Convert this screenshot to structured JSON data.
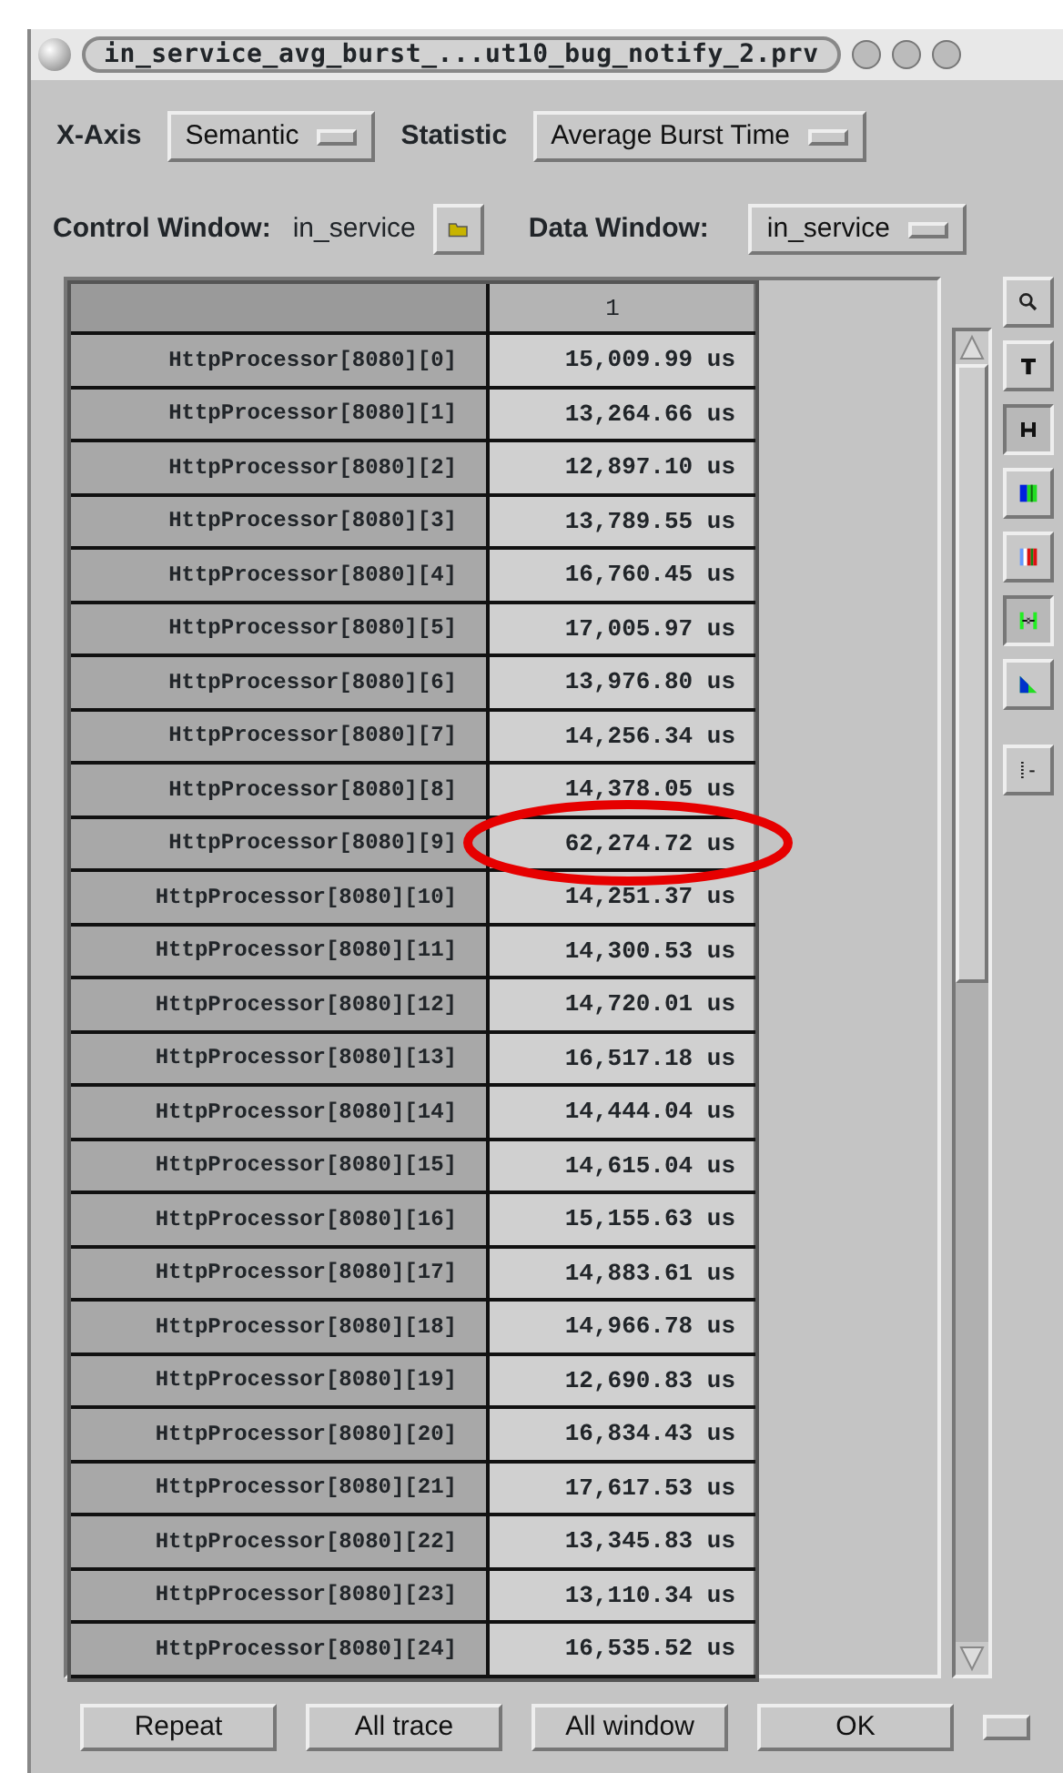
{
  "window": {
    "title": "in_service_avg_burst_...ut10_bug_notify_2.prv"
  },
  "x_axis": {
    "label": "X-Axis",
    "value": "Semantic"
  },
  "statistic": {
    "label": "Statistic",
    "value": "Average Burst Time"
  },
  "control_window": {
    "label": "Control Window:",
    "value": "in_service"
  },
  "data_window": {
    "label": "Data Window:",
    "value": "in_service"
  },
  "table": {
    "columns": [
      "1"
    ],
    "rows": [
      {
        "label": "HttpProcessor[8080][0]",
        "value": "15,009.99 us"
      },
      {
        "label": "HttpProcessor[8080][1]",
        "value": "13,264.66 us"
      },
      {
        "label": "HttpProcessor[8080][2]",
        "value": "12,897.10 us"
      },
      {
        "label": "HttpProcessor[8080][3]",
        "value": "13,789.55 us"
      },
      {
        "label": "HttpProcessor[8080][4]",
        "value": "16,760.45 us"
      },
      {
        "label": "HttpProcessor[8080][5]",
        "value": "17,005.97 us"
      },
      {
        "label": "HttpProcessor[8080][6]",
        "value": "13,976.80 us"
      },
      {
        "label": "HttpProcessor[8080][7]",
        "value": "14,256.34 us"
      },
      {
        "label": "HttpProcessor[8080][8]",
        "value": "14,378.05 us"
      },
      {
        "label": "HttpProcessor[8080][9]",
        "value": "62,274.72 us"
      },
      {
        "label": "HttpProcessor[8080][10]",
        "value": "14,251.37 us"
      },
      {
        "label": "HttpProcessor[8080][11]",
        "value": "14,300.53 us"
      },
      {
        "label": "HttpProcessor[8080][12]",
        "value": "14,720.01 us"
      },
      {
        "label": "HttpProcessor[8080][13]",
        "value": "16,517.18 us"
      },
      {
        "label": "HttpProcessor[8080][14]",
        "value": "14,444.04 us"
      },
      {
        "label": "HttpProcessor[8080][15]",
        "value": "14,615.04 us"
      },
      {
        "label": "HttpProcessor[8080][16]",
        "value": "15,155.63 us"
      },
      {
        "label": "HttpProcessor[8080][17]",
        "value": "14,883.61 us"
      },
      {
        "label": "HttpProcessor[8080][18]",
        "value": "14,966.78 us"
      },
      {
        "label": "HttpProcessor[8080][19]",
        "value": "12,690.83 us"
      },
      {
        "label": "HttpProcessor[8080][20]",
        "value": "16,834.43 us"
      },
      {
        "label": "HttpProcessor[8080][21]",
        "value": "17,617.53 us"
      },
      {
        "label": "HttpProcessor[8080][22]",
        "value": "13,345.83 us"
      },
      {
        "label": "HttpProcessor[8080][23]",
        "value": "13,110.34 us"
      },
      {
        "label": "HttpProcessor[8080][24]",
        "value": "16,535.52 us"
      }
    ]
  },
  "toolbar": [
    {
      "kind": "zoom",
      "pressed": false
    },
    {
      "kind": "text",
      "pressed": false
    },
    {
      "kind": "hist",
      "pressed": true
    },
    {
      "kind": "colors",
      "pressed": false
    },
    {
      "kind": "gradient",
      "pressed": false
    },
    {
      "kind": "shrink",
      "pressed": true
    },
    {
      "kind": "ramp",
      "pressed": false
    },
    {
      "kind": "more",
      "pressed": false
    }
  ],
  "buttons": [
    "Repeat",
    "All trace",
    "All window",
    "OK"
  ]
}
